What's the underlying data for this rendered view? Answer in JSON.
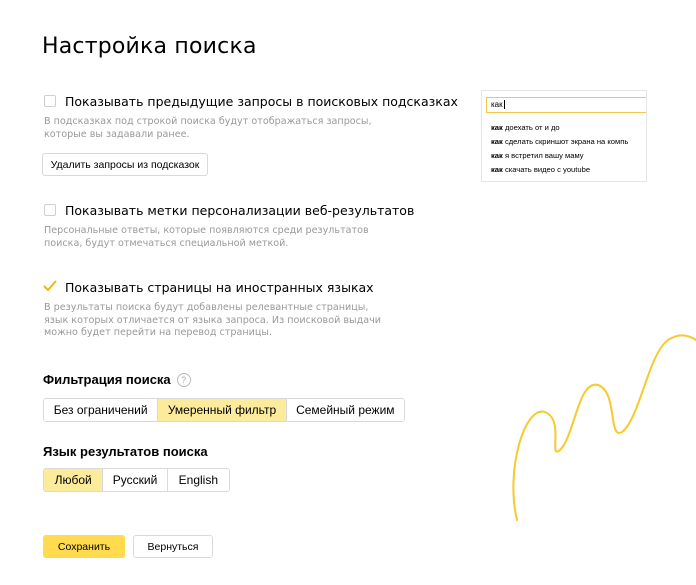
{
  "page": {
    "title": "Настройка поиска"
  },
  "options": [
    {
      "label": "Показывать предыдущие запросы в поисковых подсказках",
      "checked": false,
      "description": "В подсказках под строкой поиска будут отображаться запросы, которые вы задавали ранее."
    },
    {
      "label": "Показывать метки персонализации веб-результатов",
      "checked": false,
      "description": "Персональные ответы, которые появляются среди результатов поиска, будут отмечаться специальной меткой."
    },
    {
      "label": "Показывать страницы на иностранных языках",
      "checked": true,
      "description": "В результаты поиска будут добавлены релевантные страницы, язык которых отличается от языка запроса. Из поисковой выдачи можно будет перейти на перевод страницы."
    }
  ],
  "delete_history_button": "Удалить запросы из подсказок",
  "filter": {
    "title": "Фильтрация поиска",
    "help_icon": "question-circle-icon",
    "options": [
      "Без ограничений",
      "Умеренный фильтр",
      "Семейный режим"
    ],
    "selected": "Умеренный фильтр"
  },
  "language": {
    "title": "Язык результатов поиска",
    "options": [
      "Любой",
      "Русский",
      "English"
    ],
    "selected": "Любой"
  },
  "actions": {
    "save": "Сохранить",
    "back": "Вернуться"
  },
  "preview": {
    "query": "как",
    "suggestions": [
      {
        "bold": "как",
        "rest": "доехать от и до"
      },
      {
        "bold": "как",
        "rest": "сделать скриншот экрана на компь"
      },
      {
        "bold": "как",
        "rest": "я встретил вашу маму"
      },
      {
        "bold": "как",
        "rest": "скачать видео с youtube"
      }
    ]
  },
  "colors": {
    "accent_yellow": "#ffdb4d",
    "selected_segment": "#fdeb9c",
    "checkmark": "#f2b705",
    "muted_text": "#999999",
    "decoration_line": "#f7c92e"
  }
}
